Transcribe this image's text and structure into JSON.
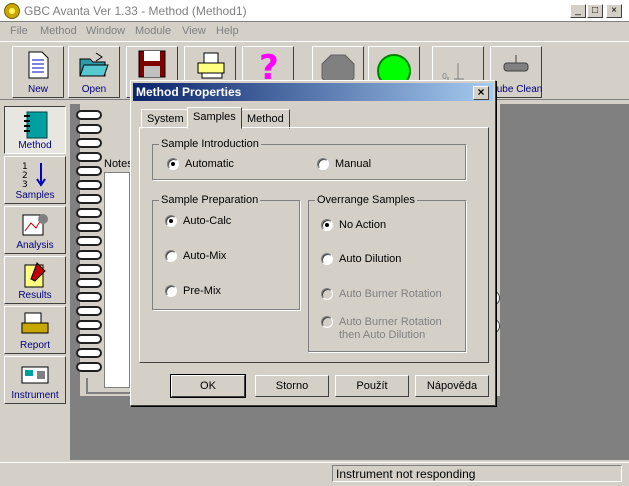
{
  "window": {
    "title": "GBC Avanta Ver 1.33 - Method (Method1)",
    "min": "_",
    "max": "□",
    "close": "×"
  },
  "menu": [
    "File",
    "Method",
    "Window",
    "Module",
    "View",
    "Help"
  ],
  "toolbar": {
    "new": "New",
    "open": "Open",
    "tube_clean": "Tube Clean"
  },
  "sidebar": [
    "Method",
    "Samples",
    "Analysis",
    "Results",
    "Report",
    "Instrument"
  ],
  "notebook": {
    "notes_label": "Notes"
  },
  "dialog": {
    "title": "Method Properties",
    "close": "×",
    "tabs": [
      "System",
      "Samples",
      "Method"
    ],
    "sample_intro": {
      "label": "Sample Introduction",
      "automatic": "Automatic",
      "manual": "Manual"
    },
    "sample_prep": {
      "label": "Sample Preparation",
      "auto_calc": "Auto-Calc",
      "auto_mix": "Auto-Mix",
      "pre_mix": "Pre-Mix"
    },
    "overrange": {
      "label": "Overrange Samples",
      "no_action": "No Action",
      "auto_dilution": "Auto Dilution",
      "auto_burner": "Auto Burner Rotation",
      "auto_burner_dilution_1": "Auto Burner Rotation",
      "auto_burner_dilution_2": "then Auto Dilution"
    },
    "buttons": {
      "ok": "OK",
      "storno": "Storno",
      "pouzit": "Použít",
      "napoveda": "Nápověda"
    }
  },
  "status": {
    "text": "Instrument not responding"
  }
}
